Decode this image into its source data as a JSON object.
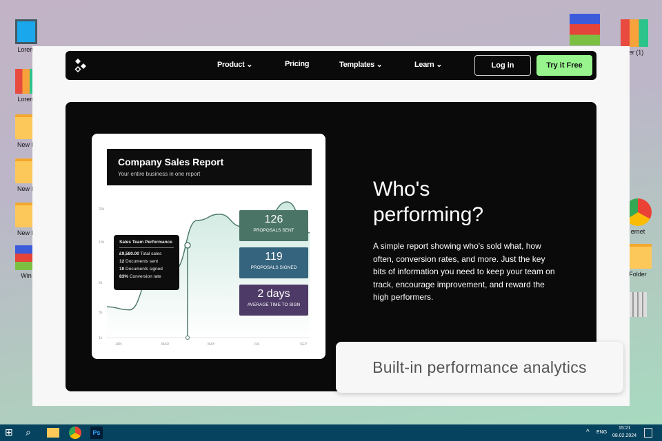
{
  "desktop": {
    "left_icons": [
      "Lorem",
      "Lorem",
      "New F",
      "New F",
      "New F",
      "Win"
    ],
    "right_icons": [
      "",
      "der (1)",
      "ernet",
      "Folder",
      ""
    ]
  },
  "nav": {
    "items": [
      "Product",
      "Pricing",
      "Templates",
      "Learn"
    ],
    "login": "Log in",
    "try": "Try it Free"
  },
  "report": {
    "title": "Company Sales Report",
    "subtitle": "Your entire business in one report",
    "tooltip": {
      "title": "Sales Team Performance",
      "lines": [
        [
          "£9,580.00",
          "Total sales"
        ],
        [
          "12",
          "Documents sent"
        ],
        [
          "10",
          "Documents signed"
        ],
        [
          "83%",
          "Conversion rate"
        ]
      ]
    },
    "stats": [
      {
        "value": "126",
        "label": "PROPOSALS SENT",
        "color": "#4a7466"
      },
      {
        "value": "119",
        "label": "PROPOSALS SIGNED",
        "color": "#35647e"
      },
      {
        "value": "2 days",
        "label": "AVERAGE TIME TO SIGN",
        "color": "#4d3a66"
      }
    ]
  },
  "chart_data": {
    "type": "area",
    "x": [
      "JAN",
      "MAR",
      "MAY",
      "JUL",
      "SEP"
    ],
    "yticks": [
      "1k",
      "3k",
      "5k",
      "10k",
      "20k"
    ],
    "series": [
      {
        "name": "Sales",
        "values": [
          5,
          4.5,
          10,
          11,
          19,
          20,
          18,
          19,
          22,
          17
        ]
      }
    ]
  },
  "hero": {
    "title_line1": "Who's",
    "title_line2": "performing?",
    "body": "A simple report showing who's sold what, how often, conversion rates, and more. Just the key bits of information you need to keep your team on track, encourage improvement, and reward the high performers."
  },
  "badge": "Built-in performance analytics",
  "taskbar": {
    "lang": "ENG",
    "time": "15:21",
    "date": "08.02.2024"
  }
}
